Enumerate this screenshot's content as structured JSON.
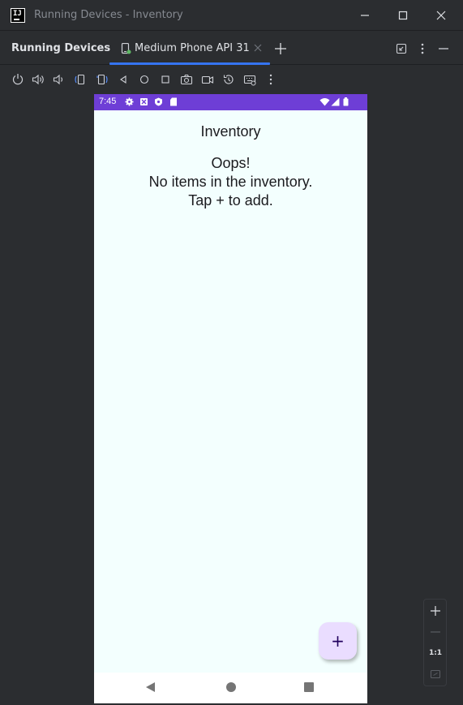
{
  "window": {
    "title": "Running Devices - Inventory",
    "logo_text": "IJ"
  },
  "tool_window": {
    "title": "Running Devices",
    "tab_label": "Medium Phone API 31"
  },
  "device_toolbar": {
    "icons": [
      "power-icon",
      "volume-up-icon",
      "volume-down-icon",
      "rotate-left-icon",
      "rotate-right-icon",
      "back-icon",
      "home-icon",
      "overview-icon",
      "screenshot-icon",
      "screen-record-icon",
      "reset-icon",
      "keyboard-icon",
      "more-options-icon"
    ]
  },
  "device": {
    "status_time": "7:45",
    "app_title": "Inventory",
    "empty_lines": [
      "Oops!",
      "No items in the inventory.",
      "Tap + to add."
    ],
    "fab_label": "+",
    "accent": "#6e3ed6",
    "screen_bg": "#f3fffe",
    "fab_bg": "#eaddff"
  },
  "zoom": {
    "ratio_label": "1:1"
  },
  "colors": {
    "ide_bg": "#2b2d30",
    "tab_underline": "#3574f0"
  }
}
